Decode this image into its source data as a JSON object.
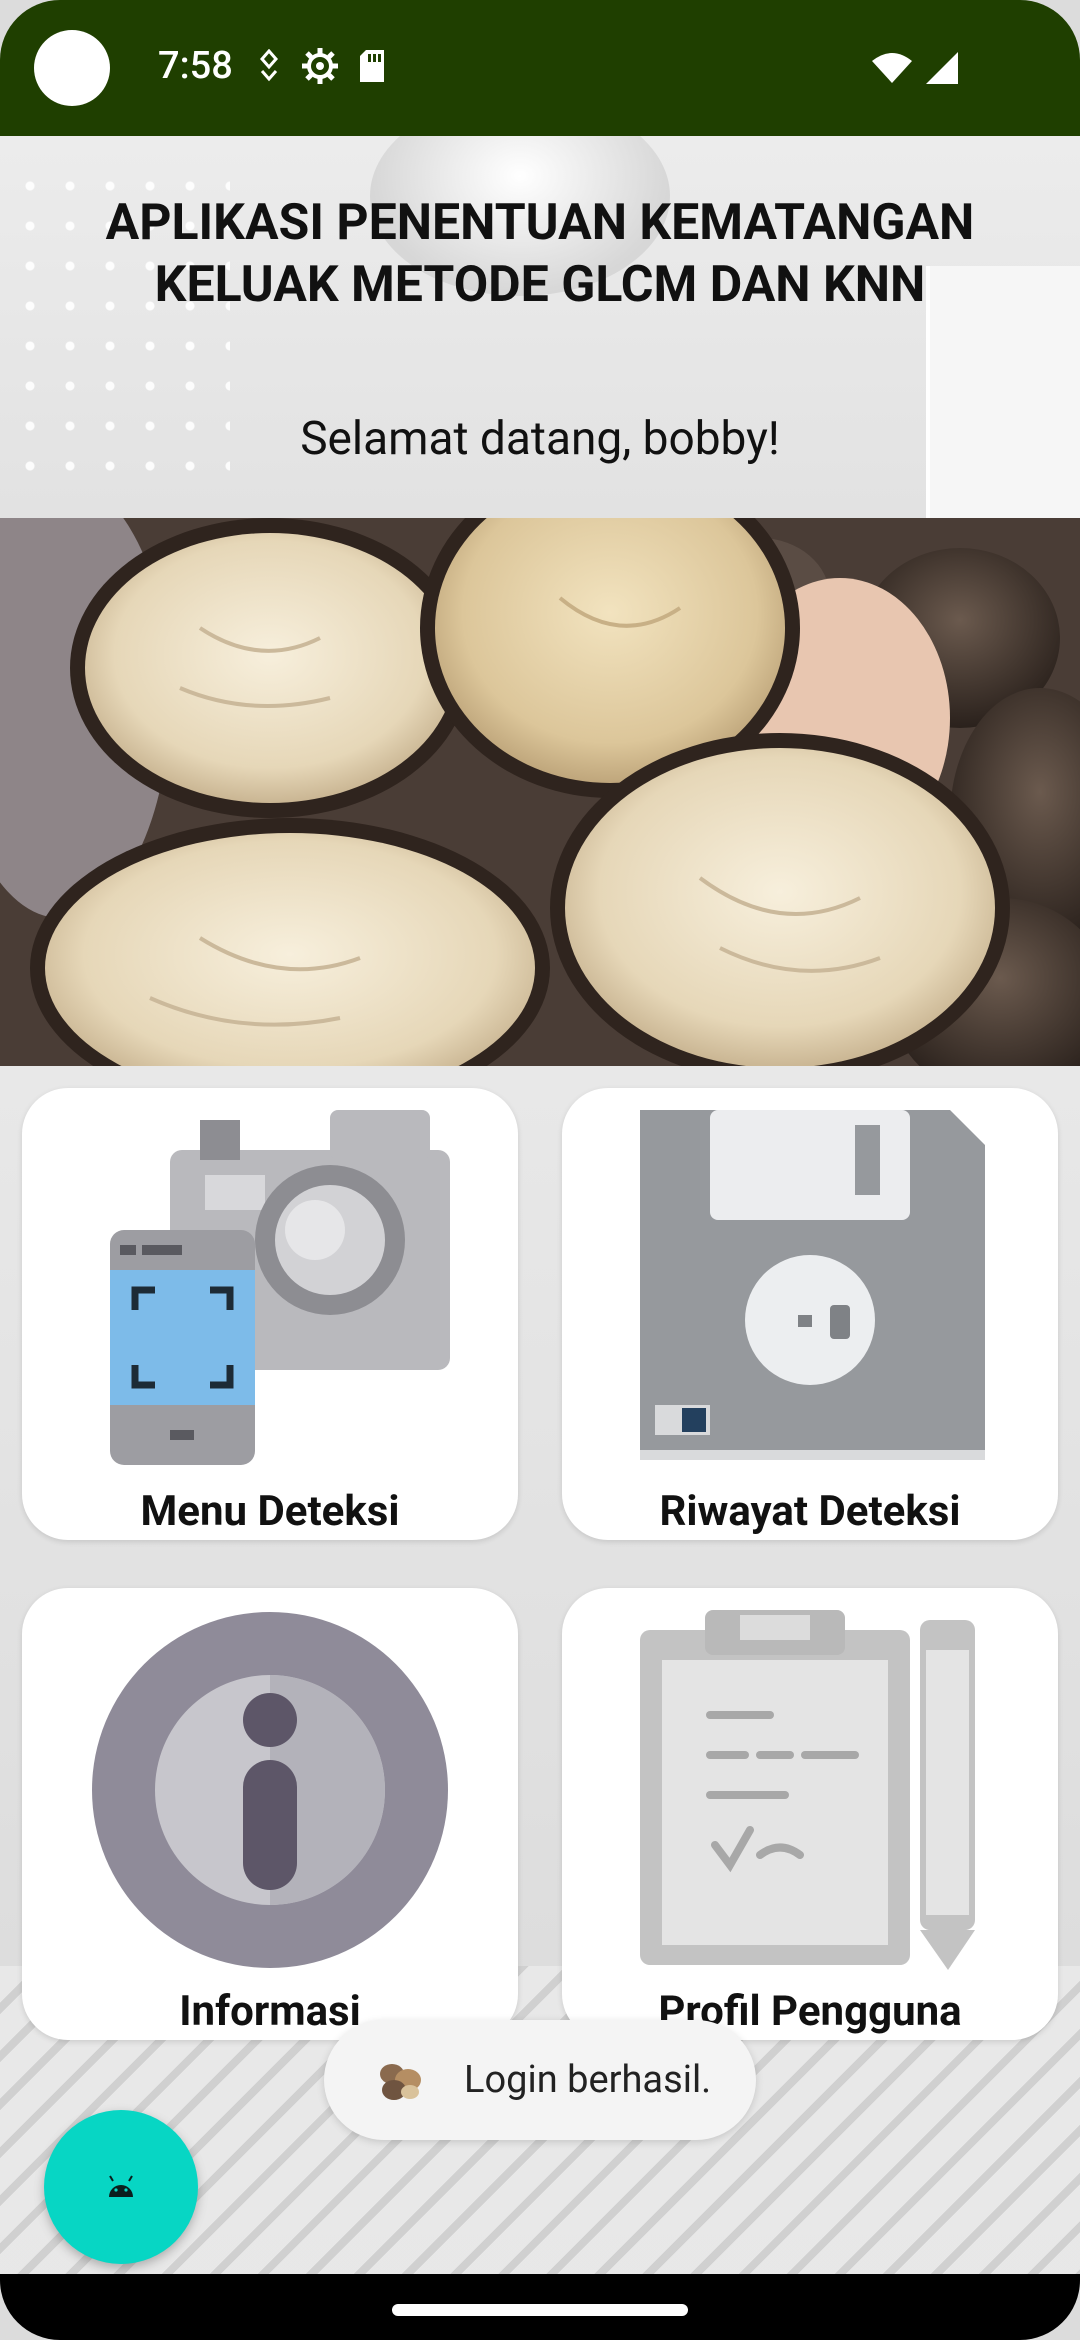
{
  "status_bar": {
    "time": "7:58",
    "icons_left": [
      "location-icon",
      "settings-icon",
      "sd-card-icon"
    ],
    "icons_right": [
      "wifi-icon",
      "signal-icon"
    ],
    "background": "#1f3f00"
  },
  "header": {
    "title": "APLIKASI PENENTUAN KEMATANGAN KELUAK METODE GLCM DAN KNN",
    "welcome": "Selamat datang, bobby!"
  },
  "menu": {
    "items": [
      {
        "label": "Menu Deteksi",
        "icon": "camera-phone-icon"
      },
      {
        "label": "Riwayat Deteksi",
        "icon": "floppy-disk-icon"
      },
      {
        "label": "Informasi",
        "icon": "info-icon"
      },
      {
        "label": "Profil Pengguna",
        "icon": "clipboard-icon"
      }
    ]
  },
  "toast": {
    "text": "Login berhasil."
  },
  "fab": {
    "icon": "android-icon",
    "color": "#07d6c4"
  }
}
